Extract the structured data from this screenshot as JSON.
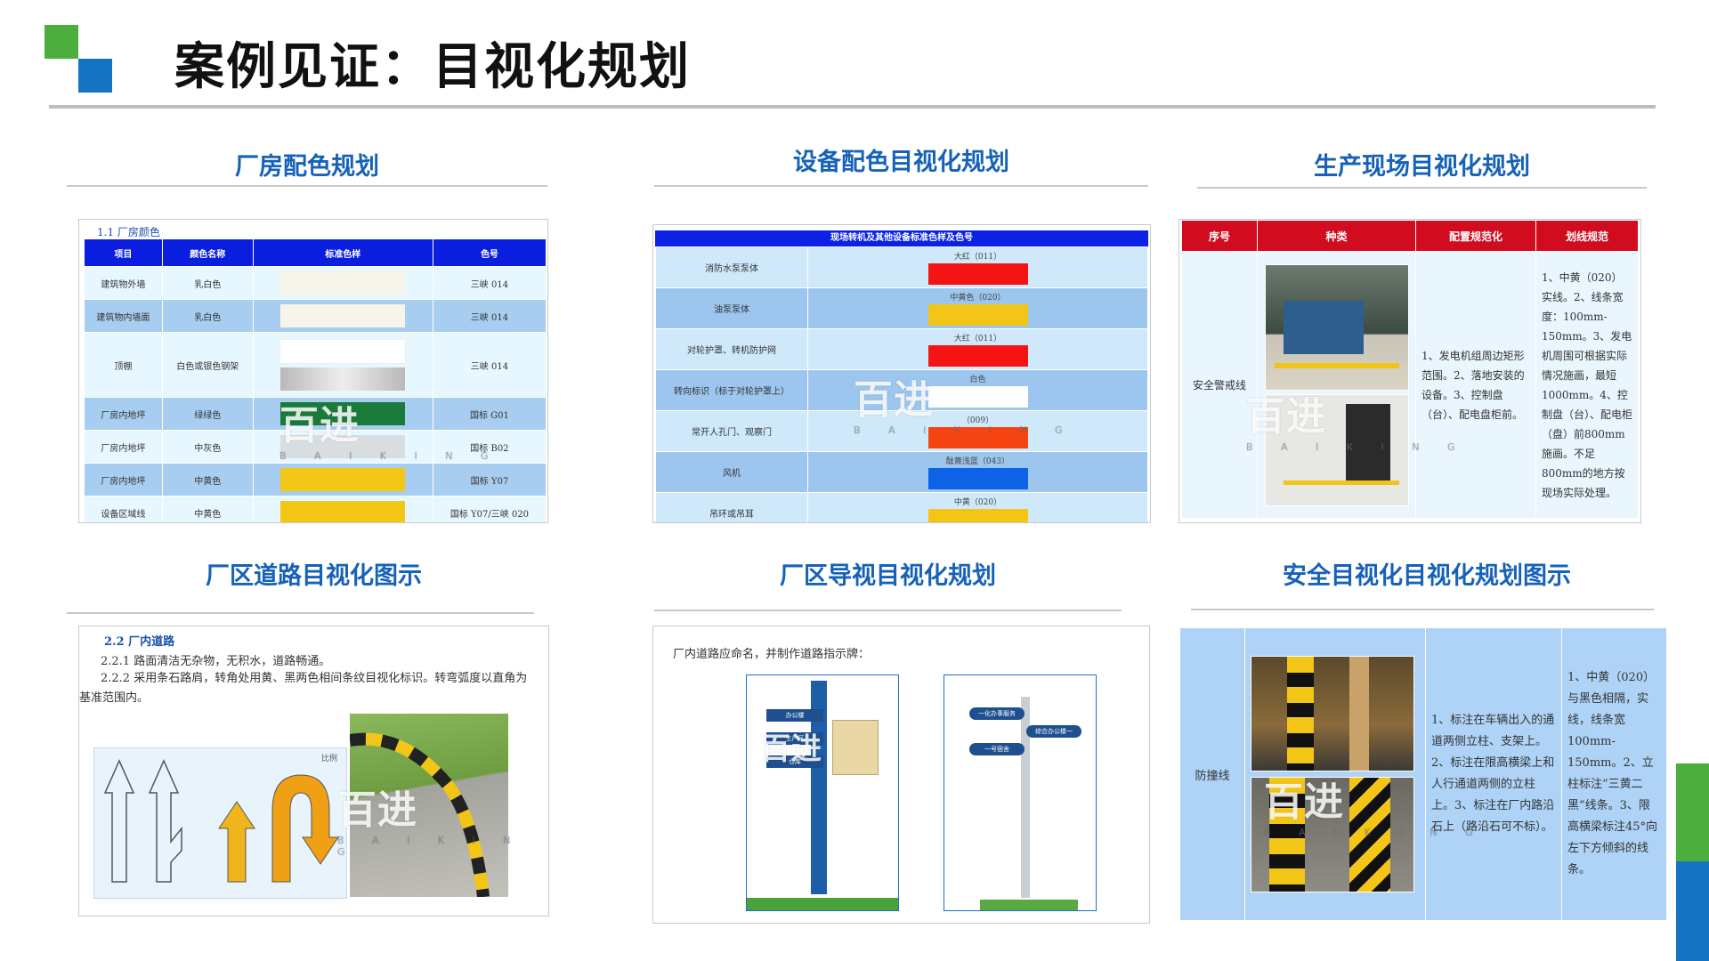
{
  "header": {
    "title": "案例见证：目视化规划"
  },
  "colors": {
    "accent_blue": "#1662b8",
    "logo_green": "#4cae3c",
    "logo_blue": "#1673c4",
    "table_header_blue": "#0a1ee0",
    "table_header_red": "#d10c1f"
  },
  "watermark": {
    "brand": "百进",
    "sub": "B A I K I N G"
  },
  "sections": {
    "s1": "厂房配色规划",
    "s2": "设备配色目视化规划",
    "s3": "生产现场目视化规划",
    "s4": "厂区道路目视化图示",
    "s5": "厂区导视目视化规划",
    "s6": "安全目视化目视化规划图示"
  },
  "p1": {
    "caption": "1.1 厂房颜色",
    "headers": [
      "项目",
      "颜色名称",
      "标准色样",
      "色号"
    ],
    "rows": [
      {
        "item": "建筑物外墙",
        "name": "乳白色",
        "code": "三峡 014"
      },
      {
        "item": "建筑物内墙面",
        "name": "乳白色",
        "code": "三峡 014"
      },
      {
        "item": "顶棚",
        "name": "白色或银色钢架",
        "code": "三峡 014"
      },
      {
        "item": "厂房内地坪",
        "name": "绿绿色",
        "code": "国标 G01"
      },
      {
        "item": "厂房内地坪",
        "name": "中灰色",
        "code": "国标 B02"
      },
      {
        "item": "厂房内地坪",
        "name": "中黄色",
        "code": "国标 Y07"
      },
      {
        "item": "设备区域线",
        "name": "中黄色",
        "code": "国标 Y07/三峡 020"
      }
    ]
  },
  "p2": {
    "header": "现场转机及其他设备标准色样及色号",
    "rows": [
      {
        "item": "消防水泵泵体",
        "color": "大红（011）"
      },
      {
        "item": "油泵泵体",
        "color": "中黄色（020）"
      },
      {
        "item": "对轮护罩、转机防护网",
        "color": "大红（011）"
      },
      {
        "item": "转向标识（标于对轮护罩上）",
        "color": "白色"
      },
      {
        "item": "常开人孔门、观察门",
        "color": "（009）"
      },
      {
        "item": "风机",
        "color": "酞菁浅蓝（043）"
      },
      {
        "item": "吊环或吊耳",
        "color": "中黄（020）"
      }
    ]
  },
  "p3": {
    "headers": [
      "序号",
      "种类",
      "配置规范化",
      "划线规范"
    ],
    "type": "安全警戒线",
    "config": "1、发电机组周边矩形范围。2、落地安装的设备。3、控制盘（台）、配电盘柜前。",
    "rule": "1、中黄（020）实线。2、线条宽度：100mm-150mm。3、发电机周围可根据实际情况施画，最短 1000mm。4、控制盘（台）、配电柜（盘）前800mm施画。不足800mm的地方按现场实际处理。"
  },
  "p4": {
    "heading": "2.2 厂内道路",
    "line1": "2.2.1 路面清洁无杂物，无积水，道路畅通。",
    "line2": "2.2.2 采用条石路肩，转角处用黄、黑两色相间条纹目视化标识。转弯弧度以直角为基准范围内。",
    "scale_label": "比例"
  },
  "p5": {
    "text": "厂内道路应命名，并制作道路指示牌：",
    "sign1": [
      "办公楼",
      "生产区",
      "仓库"
    ],
    "sign2": [
      "一化办事服务",
      "综合办公楼一",
      "一号宿舍"
    ]
  },
  "p6": {
    "type": "防撞线",
    "config": "1、标注在车辆出入的通道两侧立柱、支架上。2、标注在限高横梁上和人行通道两侧的立柱上。3、标注在厂内路沿石上（路沿石可不标）。",
    "rule": "1、中黄（020）与黑色相隔，实线，线条宽100mm-150mm。2、立柱标注“三黄二黑”线条。3、限高横梁标注45°向左下方倾斜的线条。"
  }
}
